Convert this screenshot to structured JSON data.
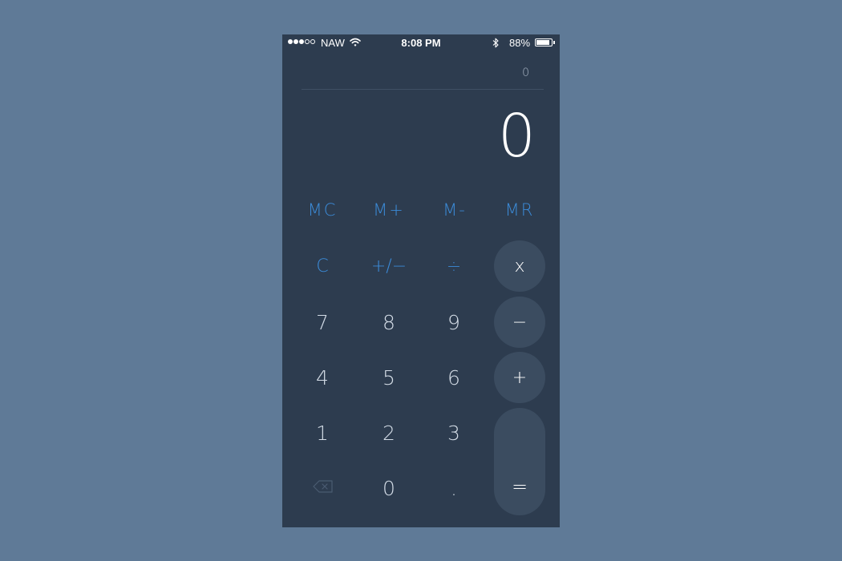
{
  "status_bar": {
    "carrier": "NAW",
    "time": "8:08 PM",
    "battery_percent": "88%",
    "battery_level": 0.88,
    "signal_bars_filled": 3,
    "signal_bars_total": 5,
    "icons": [
      "signal-dots-icon",
      "wifi-icon",
      "bluetooth-icon",
      "battery-icon"
    ]
  },
  "calculator": {
    "history_value": "0",
    "display_value": "0",
    "memory_keys": {
      "mc": "MC",
      "m_plus": "M+",
      "m_minus": "M-",
      "mr": "MR"
    },
    "function_keys": {
      "clear": "C",
      "plus_minus": "+/−",
      "divide": "÷"
    },
    "operator_keys": {
      "multiply": "x",
      "subtract": "−",
      "add": "+",
      "equals": "="
    },
    "digit_keys": {
      "seven": "7",
      "eight": "8",
      "nine": "9",
      "four": "4",
      "five": "5",
      "six": "6",
      "one": "1",
      "two": "2",
      "three": "3",
      "zero": "0",
      "decimal": "."
    },
    "backspace_icon": "backspace-icon"
  },
  "colors": {
    "page_background": "#5f7a97",
    "app_background": "#2d3c4f",
    "accent_blue": "#3b8bd8",
    "operator_bubble": "#3b4c60",
    "digit_text": "#d3dce6"
  }
}
